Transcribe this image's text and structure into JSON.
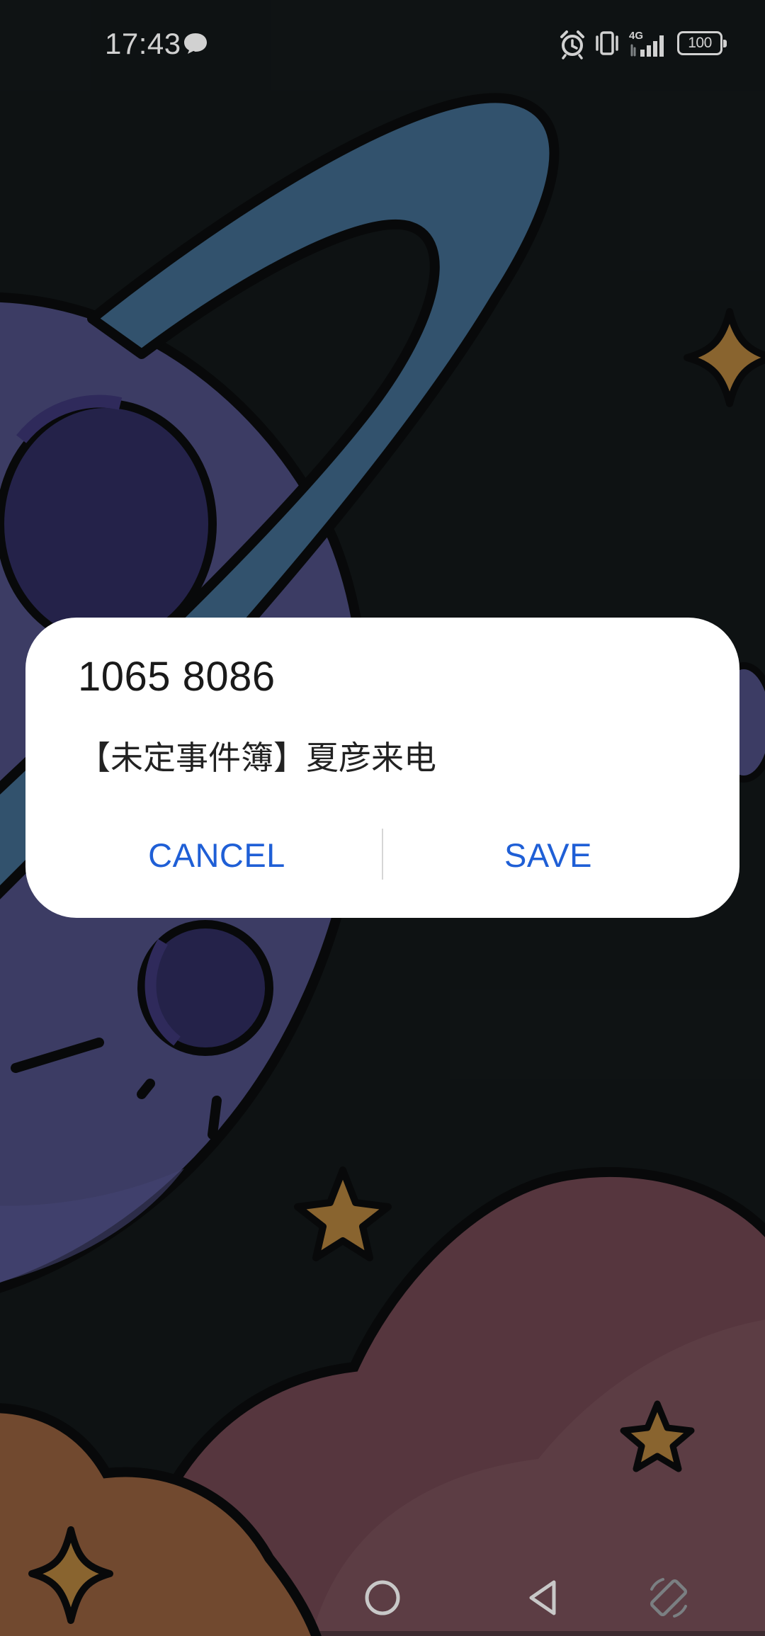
{
  "status_bar": {
    "time": "17:43",
    "network_label": "4G",
    "battery_level": "100",
    "icons": [
      "message-icon",
      "alarm-icon",
      "vibrate-icon",
      "signal-icon",
      "battery-icon"
    ]
  },
  "dialog": {
    "title": "1065 8086",
    "message": "【未定事件簿】夏彦来电",
    "cancel_label": "CANCEL",
    "save_label": "SAVE",
    "accent_color": "#1f5fd6"
  },
  "nav_bar": {
    "icons": [
      "home-icon",
      "back-icon",
      "rotate-icon"
    ]
  },
  "wallpaper": {
    "subject": "planet-and-stars",
    "colors": {
      "background": "#121718",
      "planet": "#4a4a7a",
      "ring": "#3d6585",
      "crater": "#2c2a5a",
      "star": "#a87b3a",
      "cloud_pink": "#6a424c",
      "cloud_orange": "#8a5a3a"
    }
  }
}
